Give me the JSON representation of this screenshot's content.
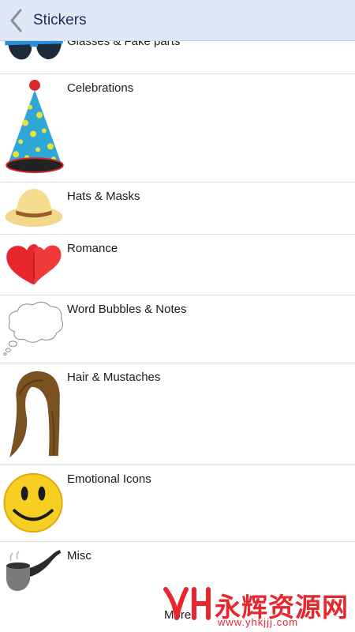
{
  "header": {
    "title": "Stickers",
    "back_icon": "chevron-left-icon",
    "background": "#dfe8f6",
    "title_color": "#1f2a5c"
  },
  "categories": [
    {
      "label": "Glasses & Fake parts",
      "icon": "sunglasses-icon"
    },
    {
      "label": "Celebrations",
      "icon": "party-hat-icon"
    },
    {
      "label": "Hats & Masks",
      "icon": "straw-hat-icon"
    },
    {
      "label": "Romance",
      "icon": "hearts-icon"
    },
    {
      "label": "Word Bubbles & Notes",
      "icon": "thought-bubble-icon"
    },
    {
      "label": "Hair & Mustaches",
      "icon": "hair-wig-icon"
    },
    {
      "label": "Emotional Icons",
      "icon": "smiley-face-icon"
    },
    {
      "label": "Misc",
      "icon": "smoking-pipe-icon"
    }
  ],
  "more": {
    "label": "More"
  },
  "watermark": {
    "text": "永辉资源网",
    "url": "www.yhkjjj.com",
    "color": "#e8262d"
  }
}
